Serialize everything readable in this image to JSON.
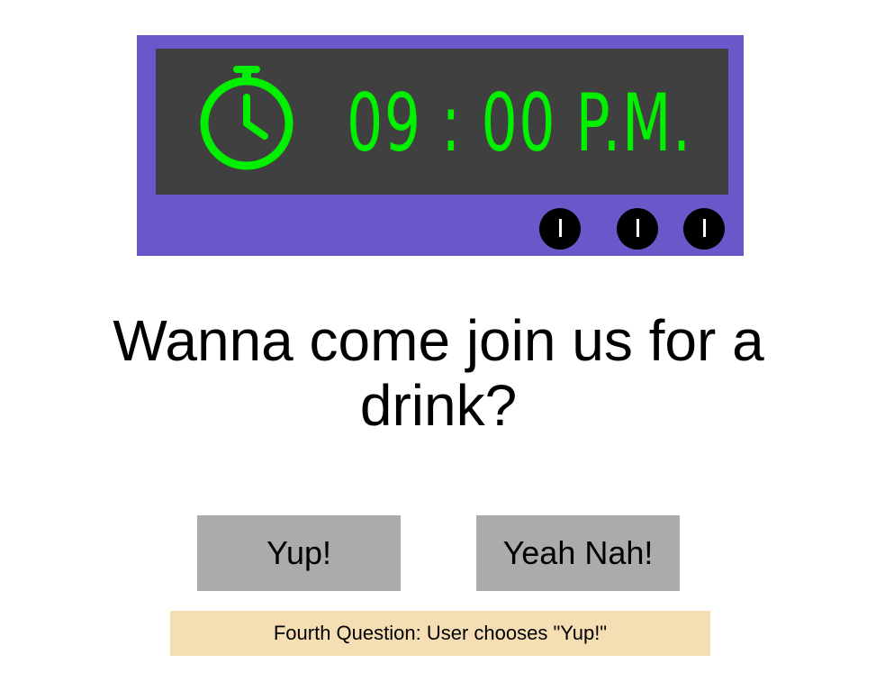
{
  "clock": {
    "time": "09 : 00 P.M.",
    "icon": "stopwatch-icon",
    "frame_color": "#6a57c9",
    "screen_color": "#404040",
    "digit_color": "#00f000",
    "buttons": [
      {
        "label": "I"
      },
      {
        "label": "I"
      },
      {
        "label": "I"
      }
    ]
  },
  "question": {
    "text": "Wanna come join us for a drink?"
  },
  "answers": {
    "yes_label": "Yup!",
    "no_label": "Yeah Nah!",
    "button_color": "#ababab"
  },
  "caption": {
    "text": "Fourth Question: User chooses \"Yup!\"",
    "background": "#f6deb4"
  }
}
